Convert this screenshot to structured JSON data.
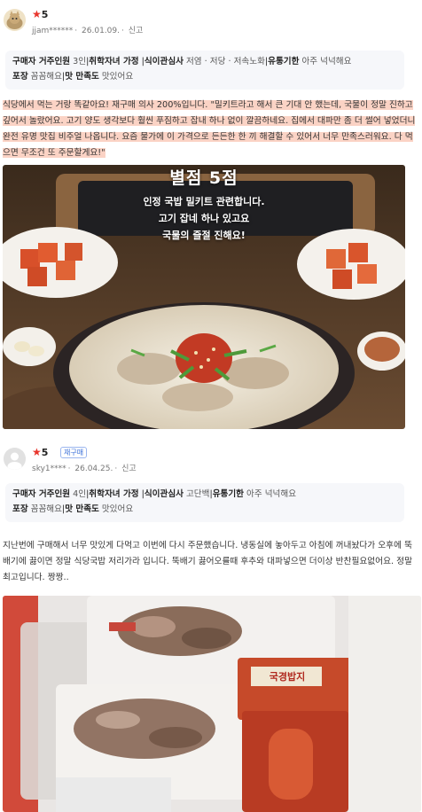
{
  "reviews": [
    {
      "rating": "5",
      "user": "jjam******",
      "date": "26.01.09.",
      "report": "신고",
      "attributes": [
        {
          "key": "구매자 거주인원",
          "value": "3인"
        },
        {
          "key": "취학자녀 가정",
          "value": ""
        },
        {
          "key": "식이관심사",
          "value": "저염 · 저당 · 저속노화"
        },
        {
          "key": "유통기한",
          "value": "아주 넉넉해요"
        },
        {
          "key": "포장",
          "value": "꼼꼼해요"
        },
        {
          "key": "맛 만족도",
          "value": "맛있어요"
        }
      ],
      "text_plain_1": "식당에서 먹는 거랑 똑같아요! 재구매 의사 200%입니다. \"밀키트라고 해서 큰 기대 안 했는데, 국물이 정말 진하고 깊어서 놀랐어요. 고기 양도 생각보다 훨씬 푸짐하고 잡내 하나 없이 깔끔하네요. 집에서 대파만 좀 더 썰어 넣었더니 완전 유명 맛집 비주얼 나옵니다. 요즘 물가에 이 가격으로 든든한 한 끼 해결할 수 있어서 너무 만족스러워요. 다 먹으면 무조건 또 주문할게요!\"",
      "photo_text": {
        "title": "별점 5점",
        "line1": "인정 국밥 밀키트 관련합니다.",
        "line2": "고기 잡네 하나 있고요",
        "line3": "국물의 즐절 진해요!"
      }
    },
    {
      "rating": "5",
      "user": "sky1****",
      "badge": "재구매",
      "date": "26.04.25.",
      "report": "신고",
      "attributes": [
        {
          "key": "구매자 거주인원",
          "value": "4인"
        },
        {
          "key": "취학자녀 가정",
          "value": ""
        },
        {
          "key": "식이관심사",
          "value": "고단백"
        },
        {
          "key": "유통기한",
          "value": "아주 넉넉해요"
        },
        {
          "key": "포장",
          "value": "꼼꼼해요"
        },
        {
          "key": "맛 만족도",
          "value": "맛있어요"
        }
      ],
      "text": "지난번에 구매해서 너무 맛있게 다먹고 이번에 다시 주문했습니다. 냉동실에 놓아두고 아침에 꺼내놨다가 오후에 뚝배기에 끓이면 정말 식당국밥 저리가라 입니다. 뚝배기 끓어오를때 후추와 대파넣으면 더이상 반찬필요없어요. 정말 최고입니다. 짱짱..",
      "photo_text": {
        "pouch": "국경밥지"
      }
    }
  ]
}
